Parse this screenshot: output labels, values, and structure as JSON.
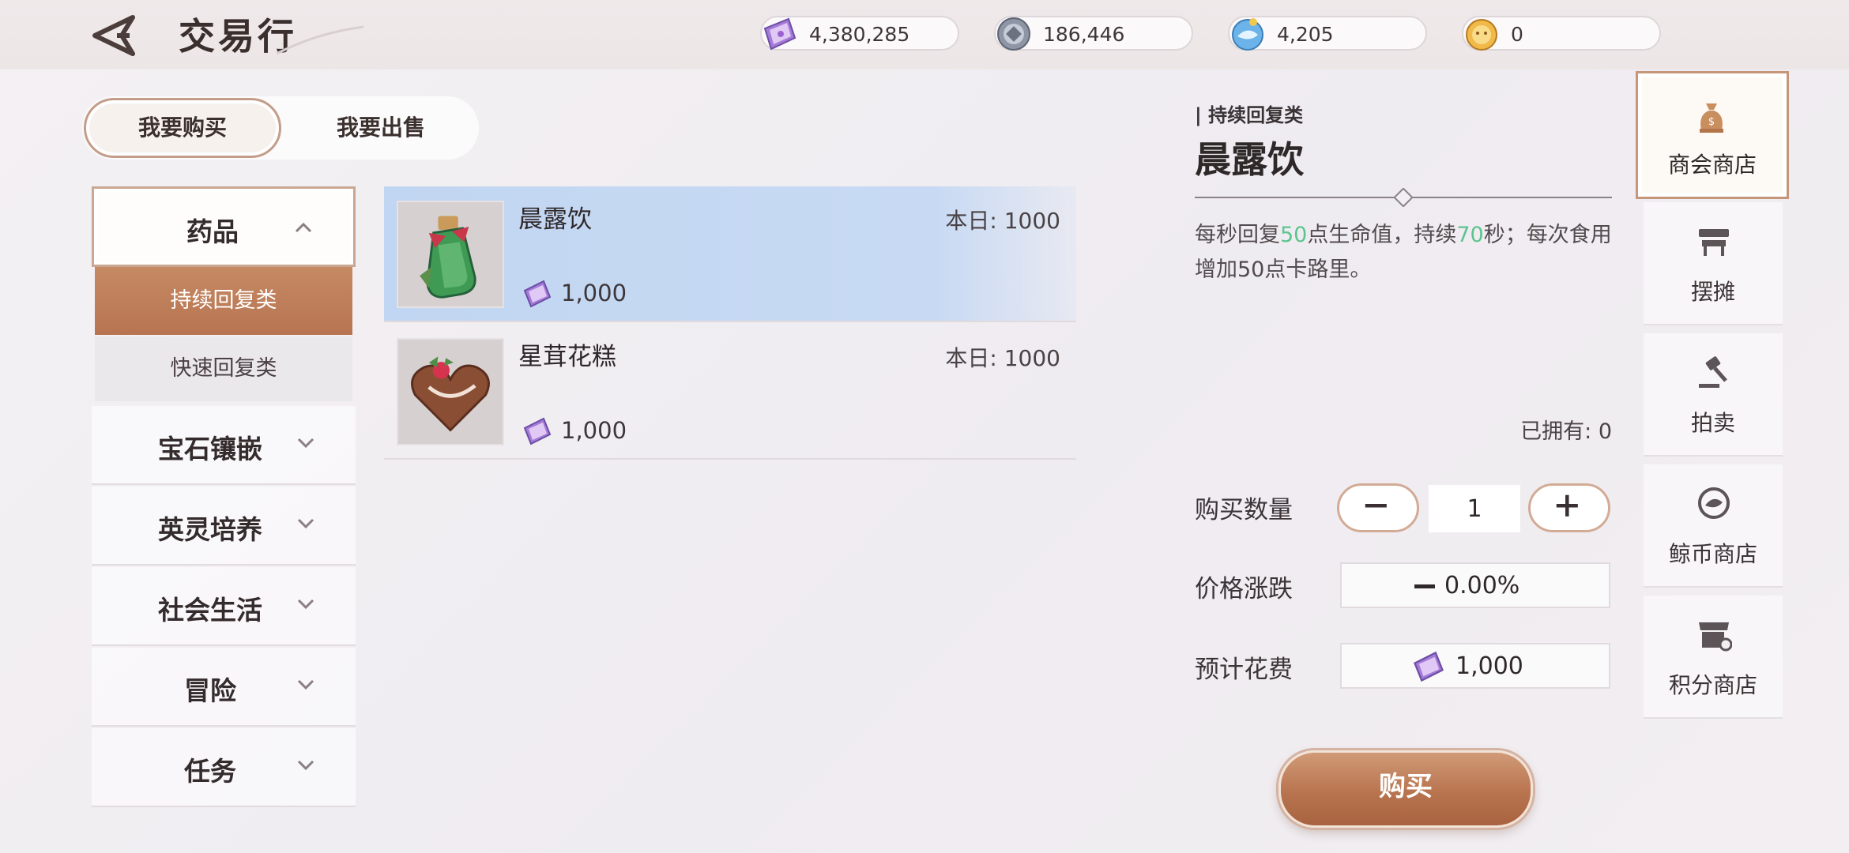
{
  "header": {
    "title": "交易行",
    "currencies": [
      {
        "icon": "purple-ticket-icon",
        "value": "4,380,285"
      },
      {
        "icon": "silver-coin-icon",
        "value": "186,446"
      },
      {
        "icon": "blue-whale-coin-icon",
        "value": "4,205"
      },
      {
        "icon": "gold-coin-icon",
        "value": "0"
      }
    ]
  },
  "mode_tabs": {
    "buy": "我要购买",
    "sell": "我要出售",
    "active": "buy"
  },
  "categories": [
    {
      "label": "药品",
      "expanded": true,
      "subcategories": [
        {
          "label": "持续回复类",
          "selected": true
        },
        {
          "label": "快速回复类",
          "selected": false
        }
      ]
    },
    {
      "label": "宝石镶嵌",
      "expanded": false
    },
    {
      "label": "英灵培养",
      "expanded": false
    },
    {
      "label": "社会生活",
      "expanded": false
    },
    {
      "label": "冒险",
      "expanded": false
    },
    {
      "label": "任务",
      "expanded": false
    }
  ],
  "items": [
    {
      "name": "晨露饮",
      "daily": "本日: 1000",
      "price": "1,000",
      "selected": true,
      "icon": "green-potion-bottle-icon"
    },
    {
      "name": "星茸花糕",
      "daily": "本日: 1000",
      "price": "1,000",
      "selected": false,
      "icon": "chocolate-heart-cake-icon"
    }
  ],
  "detail": {
    "category": "| 持续回复类",
    "name": "晨露饮",
    "desc": {
      "p1": "每秒回复",
      "v1": "50",
      "p2": "点生命值，持续",
      "v2": "70",
      "p3": "秒；每次食用增加50点卡路里。"
    },
    "owned": "已拥有: 0",
    "quantity_label": "购买数量",
    "quantity": "1",
    "price_change_label": "价格涨跌",
    "price_change": "0.00%",
    "cost_label": "预计花费",
    "cost": "1,000",
    "buy_label": "购买"
  },
  "right_nav": [
    {
      "label": "商会商店",
      "icon": "money-bag-icon",
      "active": true
    },
    {
      "label": "摆摊",
      "icon": "stall-icon",
      "active": false
    },
    {
      "label": "拍卖",
      "icon": "gavel-icon",
      "active": false
    },
    {
      "label": "鲸币商店",
      "icon": "whale-coin-icon",
      "active": false
    },
    {
      "label": "积分商店",
      "icon": "shop-points-icon",
      "active": false
    }
  ],
  "colors": {
    "accent": "#b8744f",
    "highlight_green": "#5bc58e",
    "selection_blue": "#c1d6f2"
  }
}
